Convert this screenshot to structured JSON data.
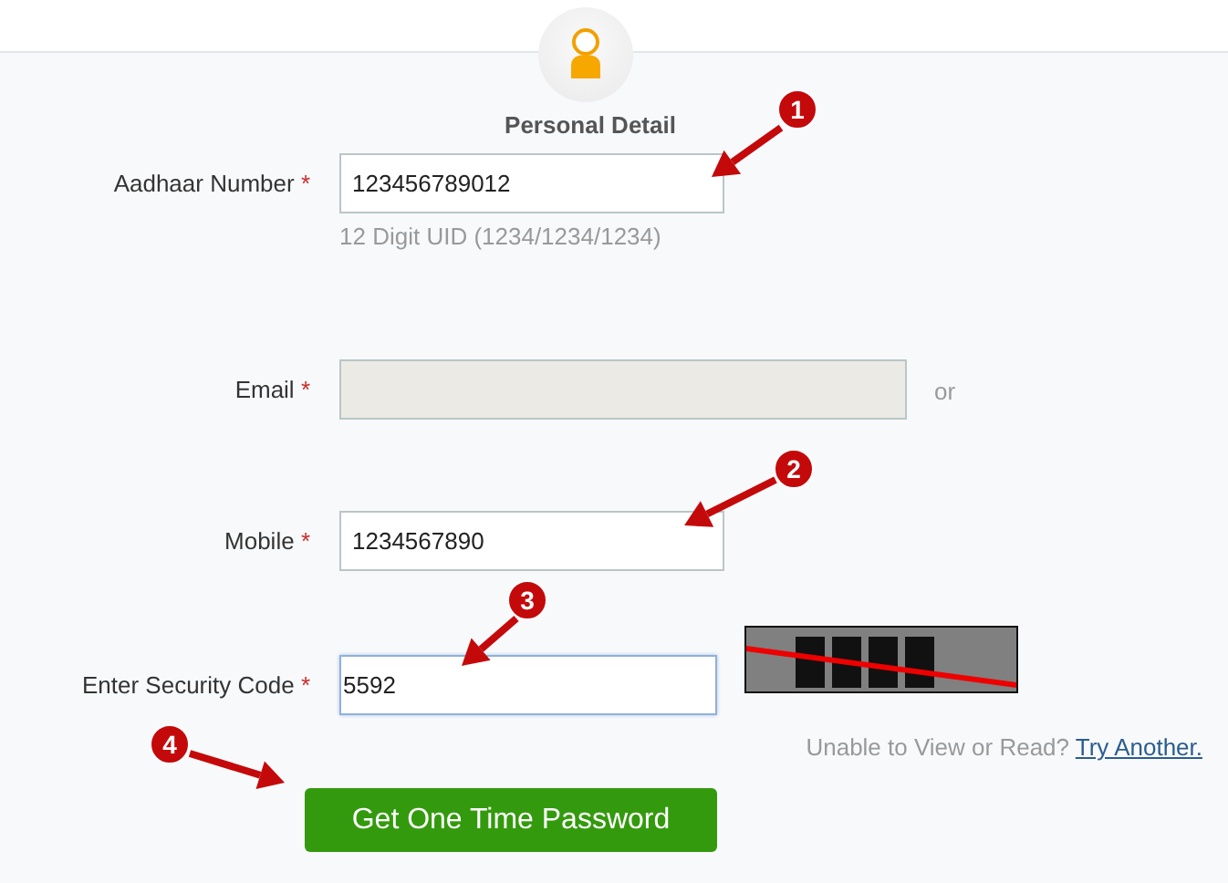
{
  "section": {
    "title": "Personal Detail"
  },
  "fields": [
    {
      "kind": "text",
      "label": "Aadhaar Number",
      "marker": "*",
      "value": "123456789012",
      "hint": "12 Digit UID (1234/1234/1234)",
      "disabled": false,
      "focused": false
    },
    {
      "kind": "text",
      "label": "Email",
      "marker": "*",
      "disabled": true,
      "focused": false,
      "suffix": "or"
    },
    {
      "kind": "text",
      "label": "Mobile",
      "marker": "*",
      "value": "1234567890",
      "disabled": false,
      "focused": false
    },
    {
      "kind": "captcha",
      "label": "Enter Security Code",
      "marker": "*",
      "value": "5592",
      "disabled": false,
      "focused": true
    }
  ],
  "captcha": {
    "kind": "picture",
    "help": "Unable to View or Read?",
    "link": "Try Another."
  },
  "submit": {
    "label": "Get One Time Password"
  },
  "annotations": [
    {
      "label": "1"
    },
    {
      "label": "2"
    },
    {
      "label": "3"
    },
    {
      "label": "4"
    }
  ]
}
